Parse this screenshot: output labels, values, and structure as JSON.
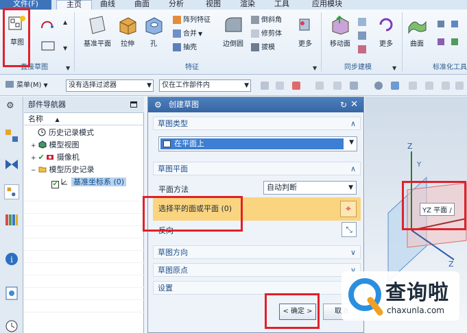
{
  "menu_tabs": [
    "文件(F)",
    "主页",
    "曲线",
    "曲面",
    "分析",
    "视图",
    "渲染",
    "工具",
    "应用模块"
  ],
  "ribbon": {
    "sketch": "草图",
    "direct_sketch_group": "直接草图",
    "datum_plane": "基准平面",
    "extrude": "拉伸",
    "hole": "孔",
    "pattern_feature": "阵列特征",
    "unite": "合并",
    "shell": "抽壳",
    "edge_blend": "边倒圆",
    "chamfer": "倒斜角",
    "trim_body": "修剪体",
    "draft": "拔模",
    "more": "更多",
    "feature_group": "特征",
    "move_face": "移动面",
    "sync_group": "同步建模",
    "surface": "曲面",
    "std_group": "标准化工具"
  },
  "toolbar": {
    "menu_label": "菜单(M)",
    "filter": "没有选择过滤器",
    "scope": "仅在工作部件内"
  },
  "navigator": {
    "title": "部件导航器",
    "col_name": "名称",
    "items": [
      "历史记录模式",
      "模型视图",
      "摄像机",
      "模型历史记录",
      "基准坐标系 (0)"
    ]
  },
  "dialog": {
    "title": "创建草图",
    "sec_type": "草图类型",
    "type_value": "在平面上",
    "sec_plane": "草图平面",
    "plane_method_label": "平面方法",
    "plane_method_value": "自动判断",
    "select_plane": "选择平的面或平面 (0)",
    "reverse": "反向",
    "sec_orient": "草图方向",
    "sec_origin": "草图原点",
    "settings": "设置",
    "ok": "< 确定 >",
    "cancel": "取消"
  },
  "viewport": {
    "label": "YZ 平面 /"
  },
  "watermark": {
    "cn": "查询啦",
    "url": "chaxunla.com"
  },
  "colors": {
    "accent": "#3766a3",
    "selection": "#fbd480",
    "annotation": "#e0202a"
  }
}
